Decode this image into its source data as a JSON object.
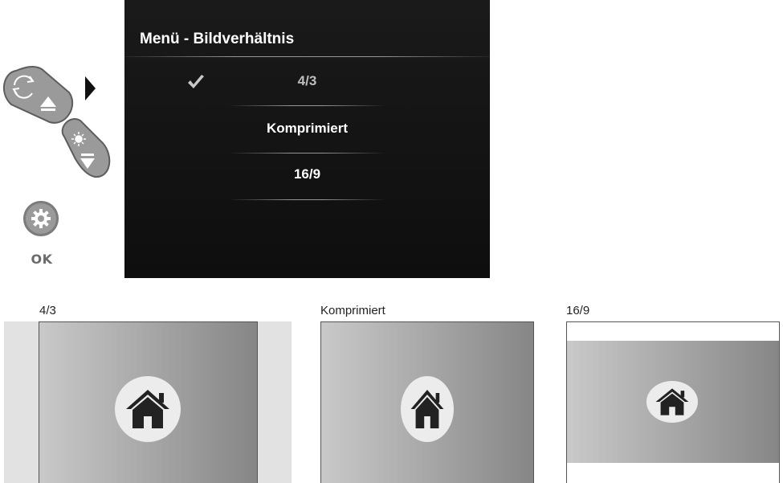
{
  "controls": {
    "ok_label": "OK",
    "icons": [
      "rotate-icon",
      "up-triangle-icon",
      "brightness-icon",
      "down-triangle-icon",
      "gear-icon",
      "right-arrow-icon"
    ]
  },
  "menu": {
    "title": "Menü - Bildverhältnis",
    "items": [
      {
        "label": "4/3",
        "selected": true
      },
      {
        "label": "Komprimiert",
        "selected": false
      },
      {
        "label": "16/9",
        "selected": false
      }
    ]
  },
  "previews": [
    {
      "caption": "4/3",
      "icon": "home-icon"
    },
    {
      "caption": "Komprimiert",
      "icon": "home-icon"
    },
    {
      "caption": "16/9",
      "icon": "home-icon"
    }
  ],
  "colors": {
    "screen_bg": "#141414",
    "menu_text": "#ffffff",
    "button_gray": "#9a9a9a",
    "pillarbox_gray": "#e2e2e2",
    "gradient_light": "#c9c9c9",
    "gradient_dark": "#868686"
  }
}
